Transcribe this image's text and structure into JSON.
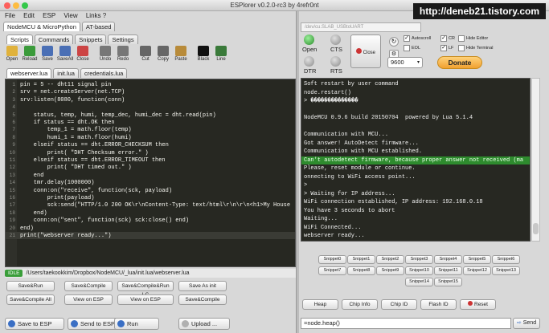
{
  "window": {
    "title": "ESPlorer v0.2.0-rc3 by 4refr0nt",
    "watermark": "http://deneb21.tistory.com"
  },
  "menu": [
    "File",
    "Edit",
    "ESP",
    "View",
    "Links ?"
  ],
  "main_tabs": [
    {
      "label": "NodeMCU & MicroPython",
      "active": true
    },
    {
      "label": "AT-based",
      "active": false
    }
  ],
  "sub_tabs": [
    {
      "label": "Scripts",
      "active": true
    },
    {
      "label": "Commands",
      "active": false
    },
    {
      "label": "Snippets",
      "active": false
    },
    {
      "label": "Settings",
      "active": false
    }
  ],
  "toolbar": [
    {
      "label": "Open",
      "icon": "folder-icon",
      "color": "#e0b23c"
    },
    {
      "label": "Reload",
      "icon": "reload-icon",
      "color": "#3b9b3b"
    },
    {
      "label": "Save",
      "icon": "save-icon",
      "color": "#4a6fb5"
    },
    {
      "label": "SaveAll",
      "icon": "save-all-icon",
      "color": "#4a6fb5"
    },
    {
      "label": "Close",
      "icon": "close-icon",
      "color": "#cc4444"
    },
    {
      "label": "Undo",
      "icon": "undo-icon",
      "color": "#777777"
    },
    {
      "label": "Redo",
      "icon": "redo-icon",
      "color": "#777777"
    },
    {
      "label": "Cut",
      "icon": "cut-icon",
      "color": "#666666"
    },
    {
      "label": "Copy",
      "icon": "copy-icon",
      "color": "#666666"
    },
    {
      "label": "Paste",
      "icon": "paste-icon",
      "color": "#b88b3a"
    },
    {
      "label": "Black",
      "icon": "theme-black-icon",
      "color": "#111111"
    },
    {
      "label": "Line",
      "icon": "line-icon",
      "color": "#3a7a3a"
    }
  ],
  "file_tabs": [
    {
      "label": "webserver.lua",
      "active": true
    },
    {
      "label": "init.lua",
      "active": false
    },
    {
      "label": "credentials.lua",
      "active": false
    }
  ],
  "code_lines": [
    "pin = 5 -- dht11 signal pin",
    "srv = net.createServer(net.TCP)",
    "srv:listen(8080, function(conn)",
    "",
    "    status, temp, humi, temp_dec, humi_dec = dht.read(pin)",
    "    if status == dht.OK then",
    "        temp_1 = math.floor(temp)",
    "        humi_1 = math.floor(humi)",
    "    elseif status == dht.ERROR_CHECKSUM then",
    "        print( \"DHT Checksum error.\" )",
    "    elseif status == dht.ERROR_TIMEOUT then",
    "        print( \"DHT timed out.\" )",
    "    end",
    "    tmr.delay(1000000)",
    "    conn:on(\"receive\", function(sck, payload)",
    "        print(payload)",
    "        sck:send(\"HTTP/1.0 200 OK\\r\\nContent-Type: text/html\\r\\n\\r\\n<h1>My House",
    "    end)",
    "    conn:on(\"sent\", function(sck) sck:close() end)",
    "end)",
    "print(\"webserver ready...\")"
  ],
  "status": {
    "state": "IDLE",
    "path": "/Users/taekookkim/Dropbox/NodeMCU/_lua/init.lua/webserver.lua"
  },
  "action_buttons": [
    [
      "Save&Run",
      "Save&Compile",
      "Save&Compile&Run LC",
      "Save As init"
    ],
    [
      "Save&Compile All",
      "View on ESP",
      "View on ESP",
      "Save&Compile"
    ]
  ],
  "bottom_buttons": [
    "Save to ESP",
    "Send to ESP",
    "Run",
    "Upload ..."
  ],
  "port": {
    "path": "/dev/cu.SLAB_USBtoUART",
    "baud": "9600",
    "open_label": "Open",
    "cts_label": "CTS",
    "dtr_label": "DTR",
    "rts_label": "RTS",
    "close_label": "Close"
  },
  "options": [
    {
      "label": "Autoscroll",
      "checked": true
    },
    {
      "label": "EOL",
      "checked": false
    },
    {
      "label": "CR",
      "checked": true
    },
    {
      "label": "LF",
      "checked": true
    },
    {
      "label": "Hide Editor",
      "checked": false
    },
    {
      "label": "Hide Terminal",
      "checked": false
    }
  ],
  "donate_label": "Donate",
  "terminal_lines": [
    {
      "text": "Soft restart by user command",
      "hl": false
    },
    {
      "text": "node.restart()",
      "hl": false
    },
    {
      "text": "> ��������������",
      "hl": false
    },
    {
      "text": "",
      "hl": false
    },
    {
      "text": "NodeMCU 0.9.6 build 20150704  powered by Lua 5.1.4",
      "hl": false
    },
    {
      "text": "",
      "hl": false
    },
    {
      "text": "Communication with MCU...",
      "hl": false
    },
    {
      "text": "Got answer! AutoDetect firmware...",
      "hl": false
    },
    {
      "text": "Communication with MCU established.",
      "hl": false
    },
    {
      "text": "Can't autodetect firmware, because proper answer not received (ma",
      "hl": true
    },
    {
      "text": "Please, reset module or continue.",
      "hl": false
    },
    {
      "text": "onnecting to WiFi access point...",
      "hl": false
    },
    {
      "text": ">",
      "hl": false
    },
    {
      "text": "> Waiting for IP address...",
      "hl": false
    },
    {
      "text": "WiFi connection established, IP address: 192.168.0.18",
      "hl": false
    },
    {
      "text": "You have 3 seconds to abort",
      "hl": false
    },
    {
      "text": "Waiting...",
      "hl": false
    },
    {
      "text": "WiFi Connected...",
      "hl": false
    },
    {
      "text": "webserver ready...",
      "hl": false
    }
  ],
  "snippets": [
    "Snippet0",
    "Snippet1",
    "Snippet2",
    "Snippet3",
    "Snippet4",
    "Snippet5",
    "Snippet6",
    "Snippet7",
    "Snippet8",
    "Snippet9",
    "Snippet10",
    "Snippet11",
    "Snippet12",
    "Snippet13",
    "Snippet14",
    "Snippet15"
  ],
  "chip_buttons": [
    "Heap",
    "Chip Info",
    "Chip ID",
    "Flash ID",
    "Reset"
  ],
  "command": {
    "value": "=node.heap()",
    "send_label": "Send"
  },
  "colors": {
    "editor_bg": "#272822",
    "highlight": "#2e8b2e",
    "donate": "#f0a030",
    "idle": "#3a9e3a"
  }
}
